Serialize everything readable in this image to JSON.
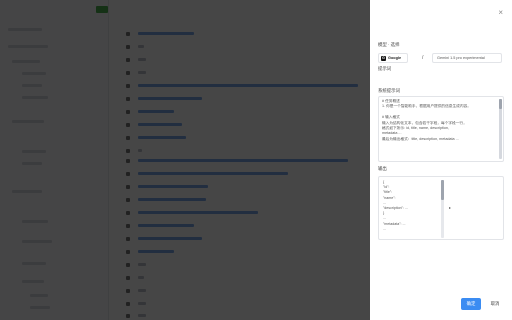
{
  "background": {
    "note_rows": [],
    "title_text": ""
  },
  "drawer": {
    "close_glyph": "×",
    "section_model_label": "模型 · 选择",
    "model_provider": "Google",
    "model_provider_glyph": "G",
    "separator": "/",
    "model_name": "Gemini 1.5 pro experimental",
    "prompt_label": "提示词",
    "system_prompt_label": "系统提示词",
    "system_prompt_lines": [
      "# 任务概述",
      "1. 你是一个智能助手，根据用户提供的信息生成内容。",
      "",
      "# 输入格式",
      "输入为结构化文本，包含若干字段，每个字段一行，",
      "格式如下所示: id, title, name, description,",
      "metadata ...",
      "最后为输出格式：title, description, metadata ..."
    ],
    "output_label": "输出",
    "output_lines": [
      "{",
      "  \"id\":",
      "  \"title\":",
      "  \"name\":",
      "  ...",
      "  \"description\": ...",
      "}",
      "...",
      "  \"metadata\": ...",
      "  ..."
    ],
    "output_right_tag": "",
    "output_arrow": "▸",
    "confirm_label": "确定",
    "cancel_label": "取消"
  },
  "colors": {
    "primary": "#3b8cf2",
    "overlay": "rgba(0,0,0,0.72)"
  }
}
